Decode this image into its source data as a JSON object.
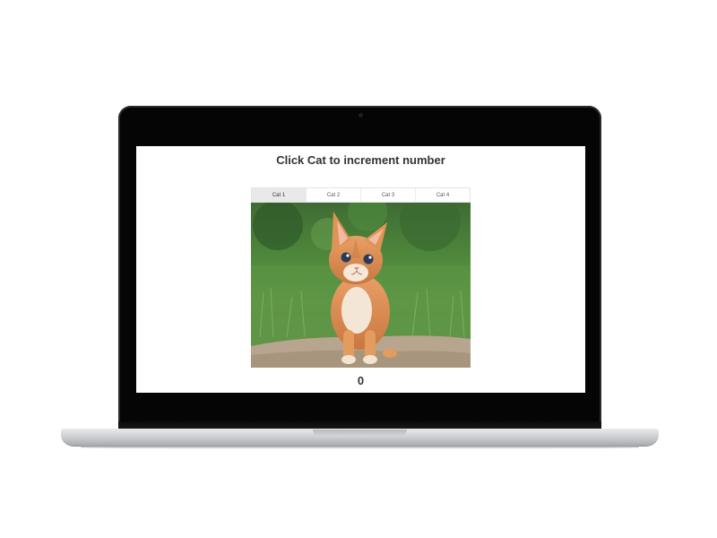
{
  "app": {
    "heading": "Click Cat to increment number"
  },
  "tabs": [
    {
      "label": "Cat 1",
      "active": true
    },
    {
      "label": "Cat 2",
      "active": false
    },
    {
      "label": "Cat 3",
      "active": false
    },
    {
      "label": "Cat 4",
      "active": false
    }
  ],
  "cat": {
    "image": "orange-kitten-photo",
    "click_count": "0"
  },
  "colors": {
    "heading_text": "#333333",
    "active_tab": "#e9e9e9",
    "bezel": "#050505"
  }
}
